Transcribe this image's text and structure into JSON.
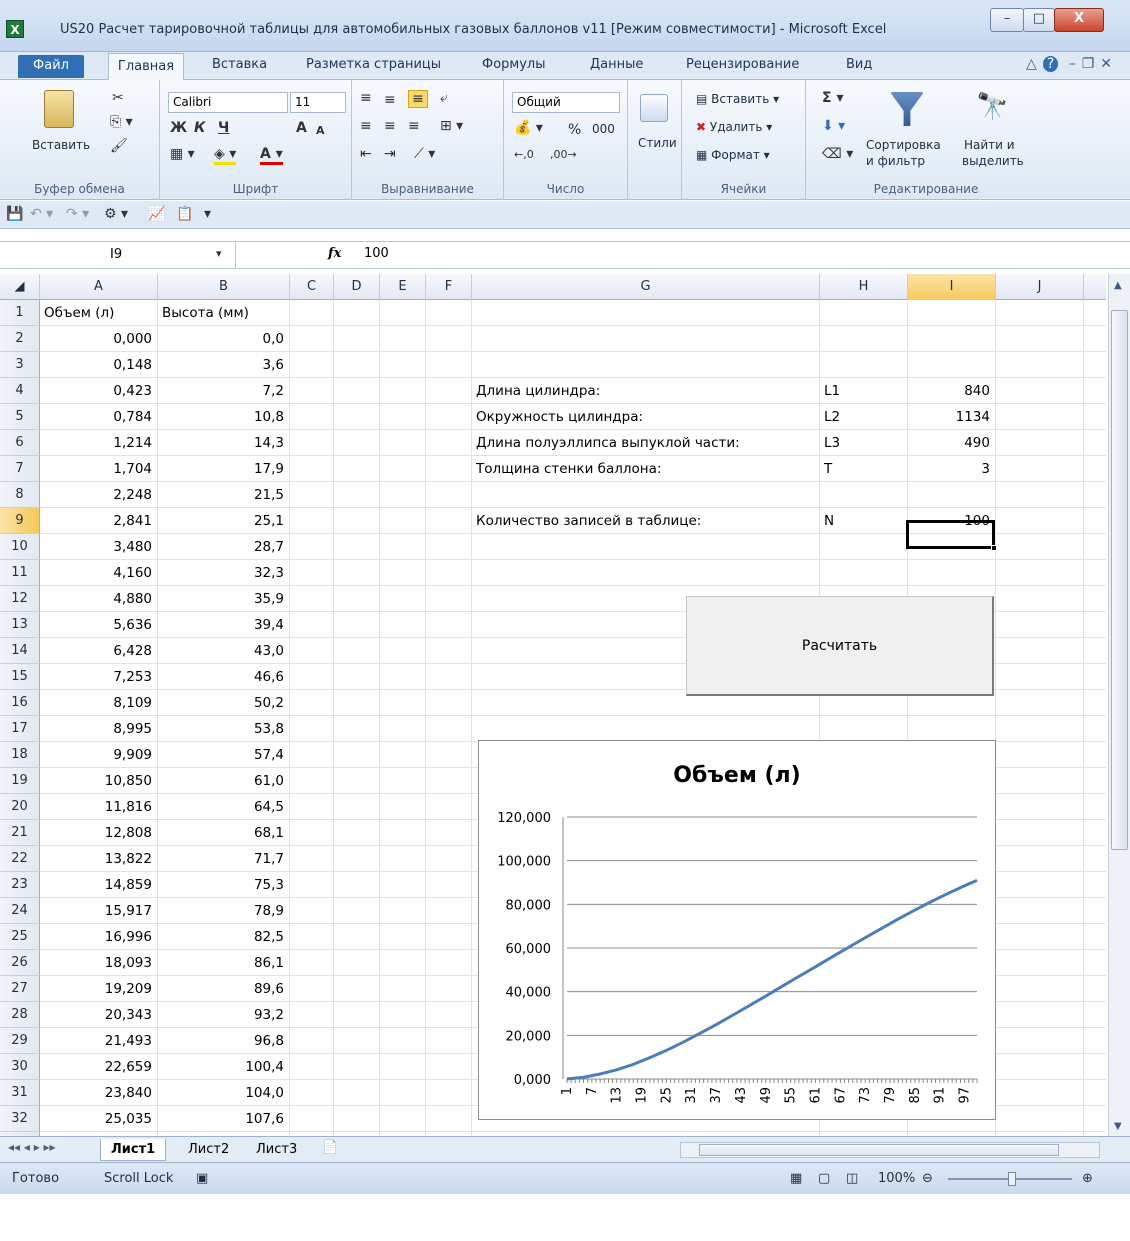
{
  "window": {
    "title": "US20 Расчет тарировочной таблицы для автомобильных газовых баллонов v11  [Режим совместимости]  -  Microsoft Excel",
    "min": "–",
    "max": "□",
    "close": "X"
  },
  "tabs": [
    "Файл",
    "Главная",
    "Вставка",
    "Разметка страницы",
    "Формулы",
    "Данные",
    "Рецензирование",
    "Вид"
  ],
  "ribbon": {
    "clipboard": {
      "paste": "Вставить",
      "label": "Буфер обмена"
    },
    "font": {
      "name": "Calibri",
      "size": "11",
      "bold": "Ж",
      "italic": "К",
      "underline": "Ч",
      "grow": "A",
      "shrink": "A",
      "label": "Шрифт"
    },
    "alignment": {
      "label": "Выравнивание"
    },
    "number": {
      "format": "Общий",
      "percent": "%",
      "thousands": "000",
      "label": "Число"
    },
    "styles": {
      "label": "Стили"
    },
    "cells": {
      "insert": "Вставить",
      "delete": "Удалить",
      "format": "Формат",
      "label": "Ячейки"
    },
    "editing": {
      "sigma": "Σ",
      "sort": "Сортировка\nи фильтр",
      "sort1": "Сортировка",
      "sort2": "и фильтр",
      "find1": "Найти и",
      "find2": "выделить",
      "label": "Редактирование"
    }
  },
  "formula_bar": {
    "name_box": "I9",
    "fx": "fx",
    "value": "100"
  },
  "columns": [
    "A",
    "B",
    "C",
    "D",
    "E",
    "F",
    "G",
    "H",
    "I",
    "J"
  ],
  "selected_column": "I",
  "selected_row": "9",
  "rows": [
    {
      "n": "1",
      "a": "Объем (л)",
      "b": "Высота (мм)"
    },
    {
      "n": "2",
      "a": "0,000",
      "b": "0,0"
    },
    {
      "n": "3",
      "a": "0,148",
      "b": "3,6"
    },
    {
      "n": "4",
      "a": "0,423",
      "b": "7,2"
    },
    {
      "n": "5",
      "a": "0,784",
      "b": "10,8"
    },
    {
      "n": "6",
      "a": "1,214",
      "b": "14,3"
    },
    {
      "n": "7",
      "a": "1,704",
      "b": "17,9"
    },
    {
      "n": "8",
      "a": "2,248",
      "b": "21,5"
    },
    {
      "n": "9",
      "a": "2,841",
      "b": "25,1"
    },
    {
      "n": "10",
      "a": "3,480",
      "b": "28,7"
    },
    {
      "n": "11",
      "a": "4,160",
      "b": "32,3"
    },
    {
      "n": "12",
      "a": "4,880",
      "b": "35,9"
    },
    {
      "n": "13",
      "a": "5,636",
      "b": "39,4"
    },
    {
      "n": "14",
      "a": "6,428",
      "b": "43,0"
    },
    {
      "n": "15",
      "a": "7,253",
      "b": "46,6"
    },
    {
      "n": "16",
      "a": "8,109",
      "b": "50,2"
    },
    {
      "n": "17",
      "a": "8,995",
      "b": "53,8"
    },
    {
      "n": "18",
      "a": "9,909",
      "b": "57,4"
    },
    {
      "n": "19",
      "a": "10,850",
      "b": "61,0"
    },
    {
      "n": "20",
      "a": "11,816",
      "b": "64,5"
    },
    {
      "n": "21",
      "a": "12,808",
      "b": "68,1"
    },
    {
      "n": "22",
      "a": "13,822",
      "b": "71,7"
    },
    {
      "n": "23",
      "a": "14,859",
      "b": "75,3"
    },
    {
      "n": "24",
      "a": "15,917",
      "b": "78,9"
    },
    {
      "n": "25",
      "a": "16,996",
      "b": "82,5"
    },
    {
      "n": "26",
      "a": "18,093",
      "b": "86,1"
    },
    {
      "n": "27",
      "a": "19,209",
      "b": "89,6"
    },
    {
      "n": "28",
      "a": "20,343",
      "b": "93,2"
    },
    {
      "n": "29",
      "a": "21,493",
      "b": "96,8"
    },
    {
      "n": "30",
      "a": "22,659",
      "b": "100,4"
    },
    {
      "n": "31",
      "a": "23,840",
      "b": "104,0"
    },
    {
      "n": "32",
      "a": "25,035",
      "b": "107,6"
    }
  ],
  "params": [
    {
      "label": "Длина цилиндра:",
      "code": "L1",
      "value": "840"
    },
    {
      "label": "Окружность цилиндра:",
      "code": "L2",
      "value": "1134"
    },
    {
      "label": "Длина полуэллипса выпуклой части:",
      "code": "L3",
      "value": "490"
    },
    {
      "label": "Толщина стенки баллона:",
      "code": "T",
      "value": "3"
    },
    {
      "label": "Количество записей в таблице:",
      "code": "N",
      "value": "100"
    }
  ],
  "button": {
    "label": "Расчитать"
  },
  "chart_data": {
    "type": "line",
    "title": "Объем (л)",
    "xlabel": "",
    "ylabel": "",
    "ylim": [
      0,
      120
    ],
    "yticks": [
      "0,000",
      "20,000",
      "40,000",
      "60,000",
      "80,000",
      "100,000",
      "120,000"
    ],
    "xticks": [
      "1",
      "7",
      "13",
      "19",
      "25",
      "31",
      "37",
      "43",
      "49",
      "55",
      "61",
      "67",
      "73",
      "79",
      "85",
      "91",
      "97"
    ],
    "x": [
      1,
      5,
      9,
      13,
      17,
      21,
      25,
      29,
      33,
      37,
      41,
      45,
      49,
      53,
      57,
      61,
      65,
      69,
      73,
      77,
      81,
      85,
      89,
      93,
      97,
      100
    ],
    "values": [
      0,
      0.8,
      2.3,
      4.2,
      6.7,
      9.8,
      13.1,
      16.8,
      20.8,
      24.9,
      29.2,
      33.6,
      38.0,
      42.5,
      47.0,
      51.4,
      55.9,
      60.3,
      64.7,
      69.0,
      73.3,
      77.4,
      81.3,
      85.0,
      88.5,
      91.0
    ]
  },
  "sheets": [
    "Лист1",
    "Лист2",
    "Лист3"
  ],
  "status": {
    "ready": "Готово",
    "scroll_lock": "Scroll Lock",
    "zoom": "100%"
  }
}
